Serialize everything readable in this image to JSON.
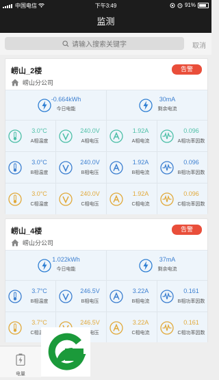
{
  "status_bar": {
    "carrier": "中国电信",
    "time": "下午3:49",
    "battery": "91%"
  },
  "navbar": {
    "title": "监测"
  },
  "search": {
    "placeholder": "请输入搜索关键字",
    "cancel_label": "取消"
  },
  "cards": [
    {
      "title": "崂山_2楼",
      "alarm_label": "告警",
      "org": "崂山分公司",
      "summary": [
        {
          "value": "-0.664kWh",
          "label": "今日电能",
          "icon": "lightning-icon"
        },
        {
          "value": "30mA",
          "label": "剩余电流",
          "icon": "lightning-icon"
        }
      ],
      "phases": [
        {
          "temp": "3.0°C",
          "temp_label": "A相温度",
          "voltage": "240.0V",
          "voltage_label": "A相电压",
          "current": "1.92A",
          "current_label": "A相电流",
          "pf": "0.096",
          "pf_label": "A相功率因数"
        },
        {
          "temp": "3.0°C",
          "temp_label": "B相温度",
          "voltage": "240.0V",
          "voltage_label": "B相电压",
          "current": "1.92A",
          "current_label": "B相电流",
          "pf": "0.096",
          "pf_label": "B相功率因数"
        },
        {
          "temp": "3.0°C",
          "temp_label": "C相温度",
          "voltage": "240.0V",
          "voltage_label": "C相电压",
          "current": "1.92A",
          "current_label": "C相电流",
          "pf": "0.096",
          "pf_label": "C相功率因数"
        }
      ]
    },
    {
      "title": "崂山_4楼",
      "alarm_label": "告警",
      "org": "崂山分公司",
      "summary": [
        {
          "value": "1.022kWh",
          "label": "今日电能",
          "icon": "lightning-icon"
        },
        {
          "value": "37mA",
          "label": "剩余电流",
          "icon": "lightning-icon"
        }
      ],
      "phases": [
        {
          "temp": "3.7°C",
          "temp_label": "B相温度",
          "voltage": "246.5V",
          "voltage_label": "B相电压",
          "current": "3.22A",
          "current_label": "B相电流",
          "pf": "0.161",
          "pf_label": "B相功率因数"
        },
        {
          "temp": "3.7°C",
          "temp_label": "C相温度",
          "voltage": "246.5V",
          "voltage_label": "C相电压",
          "current": "3.22A",
          "current_label": "C相电流",
          "pf": "0.161",
          "pf_label": "C相功率因数"
        }
      ]
    }
  ],
  "tabbar": {
    "item_label": "电量"
  },
  "colors": {
    "phase_a": "#4dbfa7",
    "phase_b": "#3c7fd0",
    "phase_c": "#e1a93a",
    "alarm": "#e94e3a",
    "icon_blue": "#2f7fd3"
  }
}
